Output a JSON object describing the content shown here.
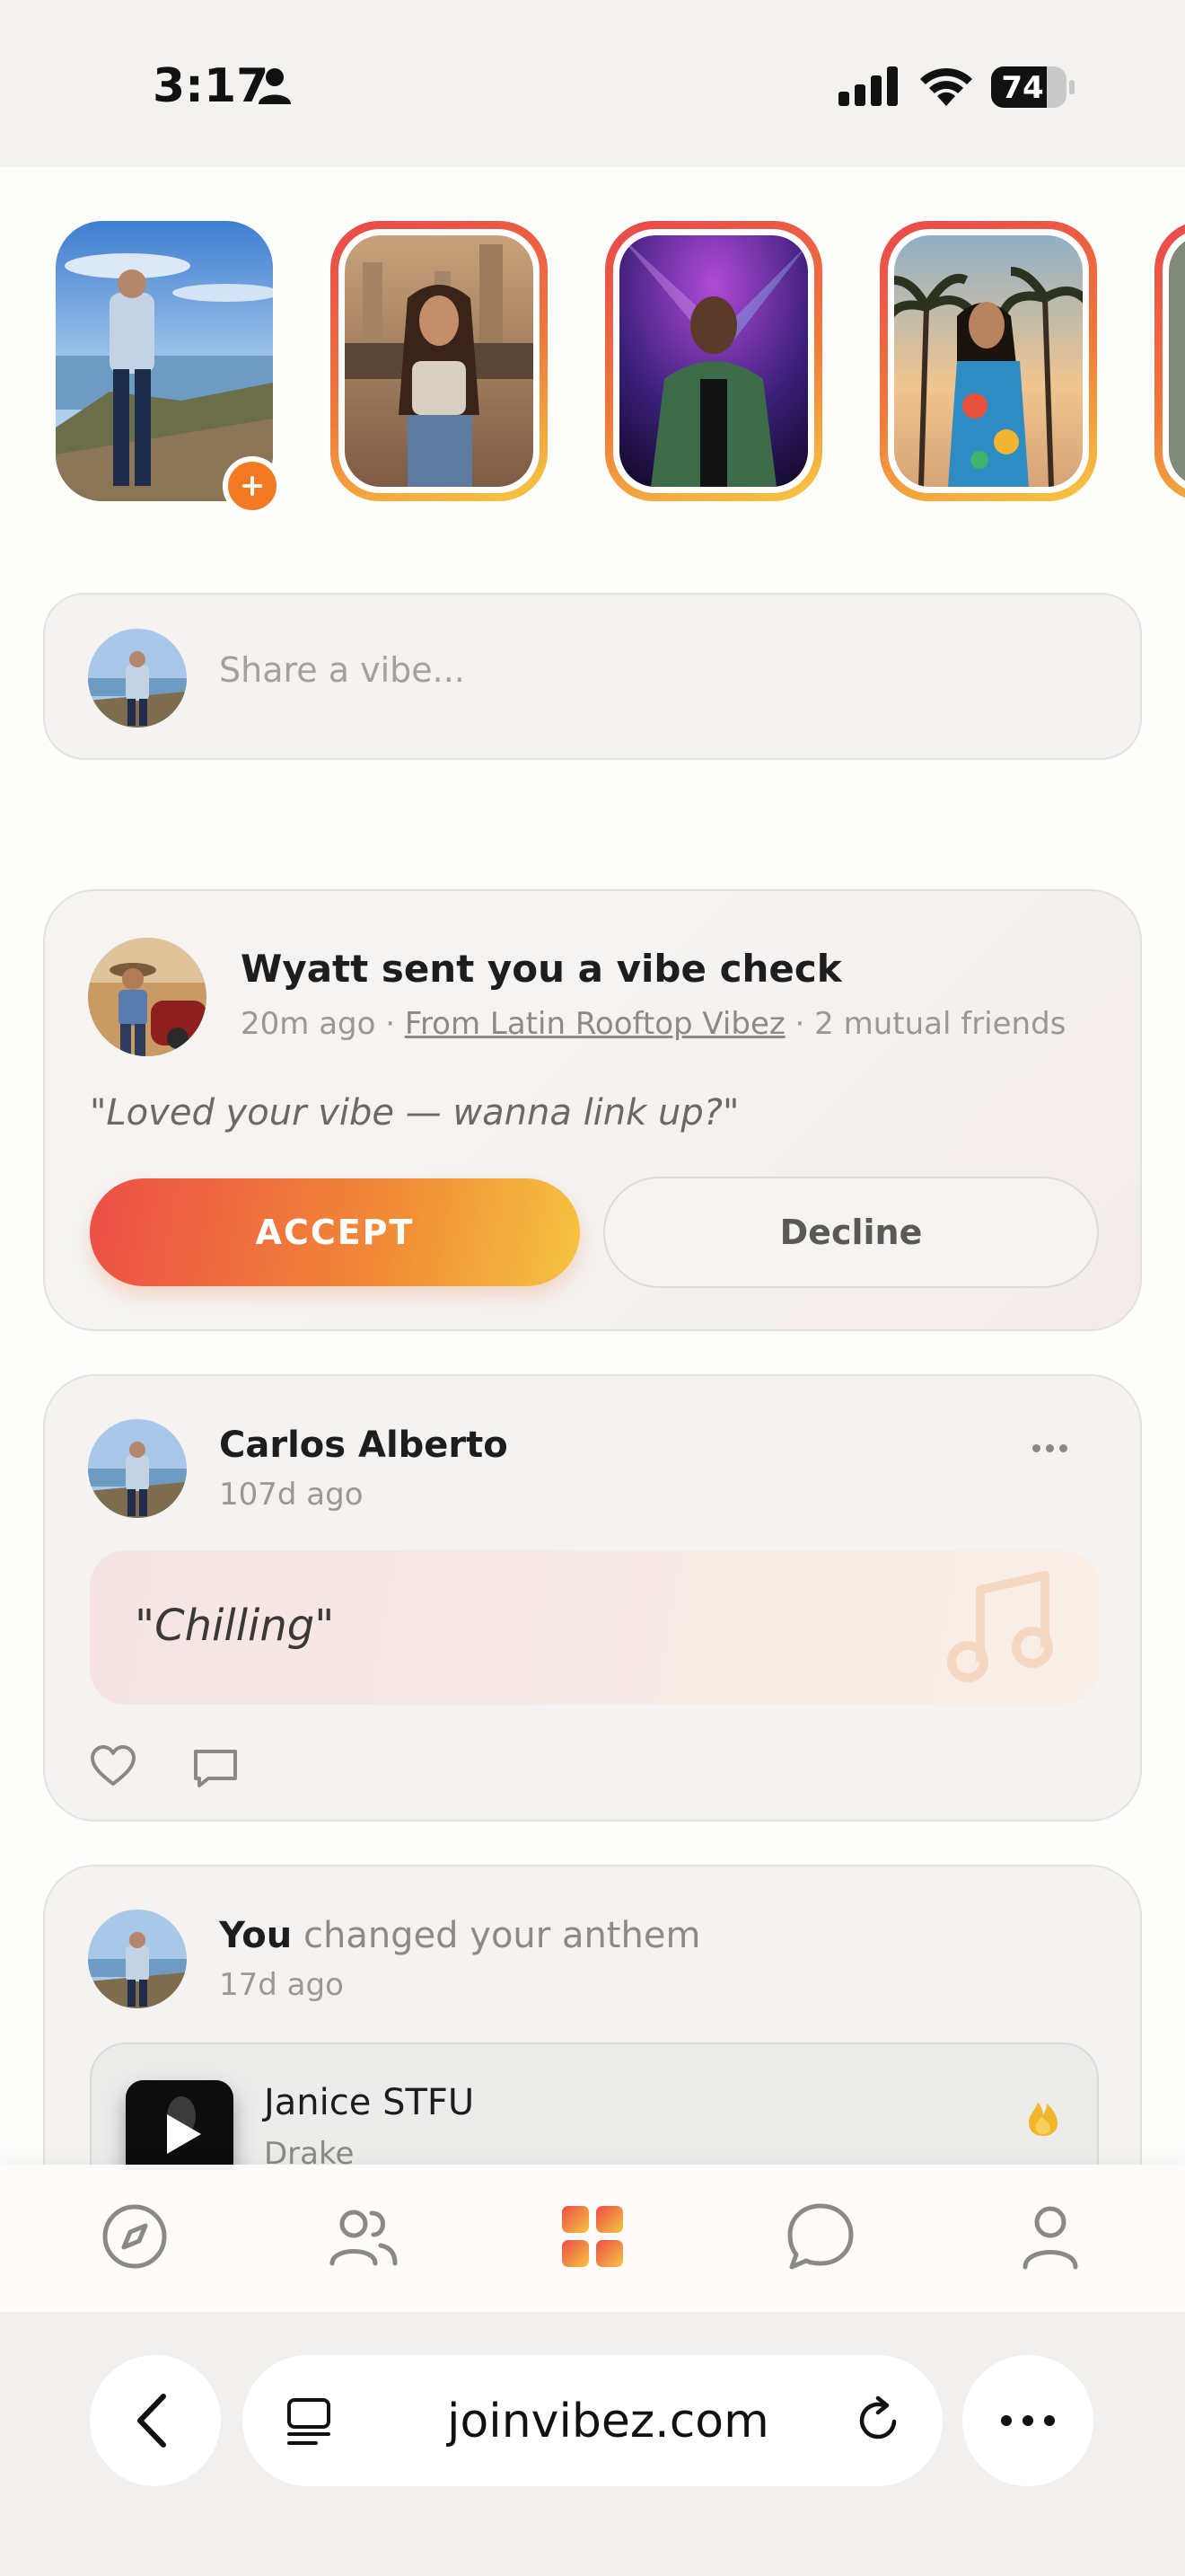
{
  "status_bar": {
    "time": "3:17",
    "battery": "74",
    "battery_level_percent": 74
  },
  "stories": [
    {
      "label": "your-story",
      "has_add_button": true
    },
    {
      "label": "story-rooftop"
    },
    {
      "label": "story-club"
    },
    {
      "label": "story-beach"
    }
  ],
  "composer": {
    "placeholder": "Share a vibe..."
  },
  "vibe_check": {
    "title": "Wyatt sent you a vibe check",
    "time": "20m ago",
    "separator": "·",
    "source": "From Latin Rooftop Vibez",
    "mutual": "2 mutual friends",
    "quote": "\"Loved your vibe — wanna link up?\"",
    "accept_label": "ACCEPT",
    "decline_label": "Decline"
  },
  "post": {
    "author": "Carlos Alberto",
    "time": "107d ago",
    "quote": "\"Chilling\""
  },
  "anthem": {
    "actor": "You",
    "action": "changed your anthem",
    "time": "17d ago",
    "track_title": "Janice STFU",
    "track_artist": "Drake"
  },
  "tabs": [
    {
      "icon": "compass-icon",
      "name": "tab-explore"
    },
    {
      "icon": "people-icon",
      "name": "tab-friends"
    },
    {
      "icon": "grid-icon",
      "name": "tab-feed",
      "active": true
    },
    {
      "icon": "chat-icon",
      "name": "tab-messages"
    },
    {
      "icon": "person-icon",
      "name": "tab-profile"
    }
  ],
  "browser": {
    "url": "joinvibez.com"
  },
  "colors": {
    "accent": "#f27a24",
    "gradient_start": "#ec4e47",
    "gradient_end": "#f6c442"
  }
}
